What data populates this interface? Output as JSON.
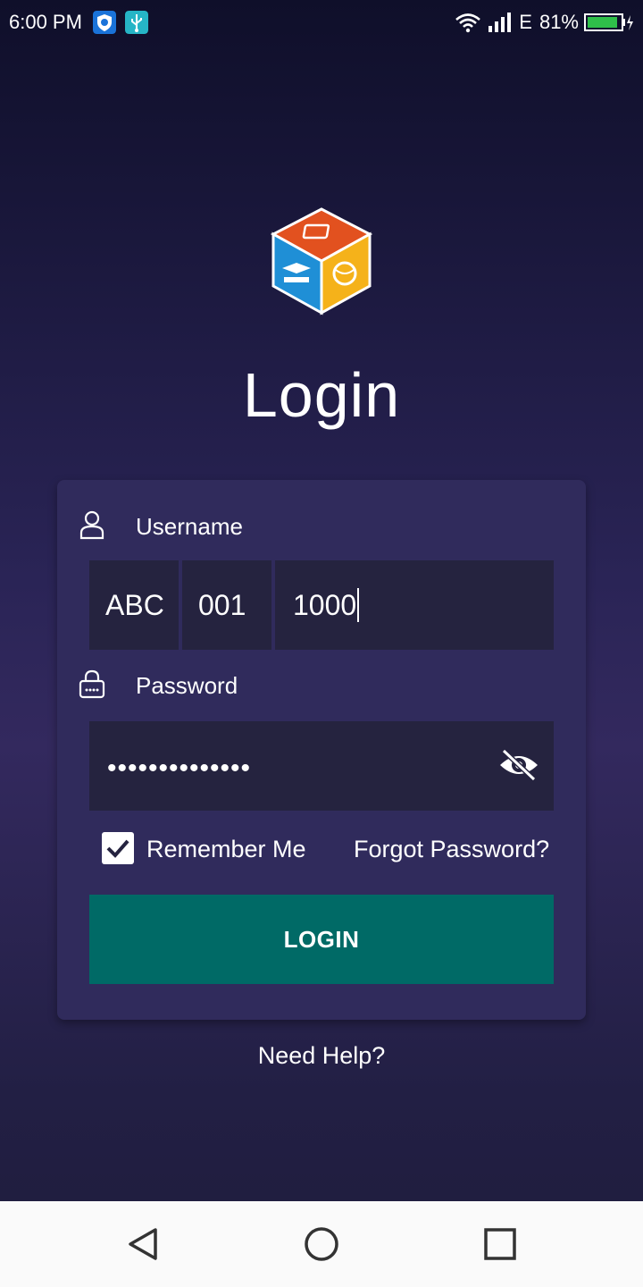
{
  "status_bar": {
    "time": "6:00 PM",
    "network": "E",
    "battery": "81%",
    "icons": [
      "shield-app-icon",
      "usb-icon",
      "wifi-icon",
      "signal-icon",
      "battery-charging-icon"
    ]
  },
  "header": {
    "title": "Login",
    "logo": "app-cube-logo"
  },
  "form": {
    "username_label": "Username",
    "username_parts": [
      "ABC",
      "001",
      "1000"
    ],
    "password_label": "Password",
    "password_masked": "••••••••••••••",
    "show_password_icon": "eye-off-icon",
    "remember_me_label": "Remember Me",
    "remember_me_checked": true,
    "forgot_password": "Forgot Password?",
    "login_button": "LOGIN"
  },
  "footer": {
    "help_link": "Need Help?"
  },
  "nav_bar": {
    "buttons": [
      "back-button",
      "home-button",
      "recents-button"
    ]
  },
  "colors": {
    "accent_button": "#006a66",
    "card": "#302b5c",
    "input_bg": "#25233f"
  }
}
